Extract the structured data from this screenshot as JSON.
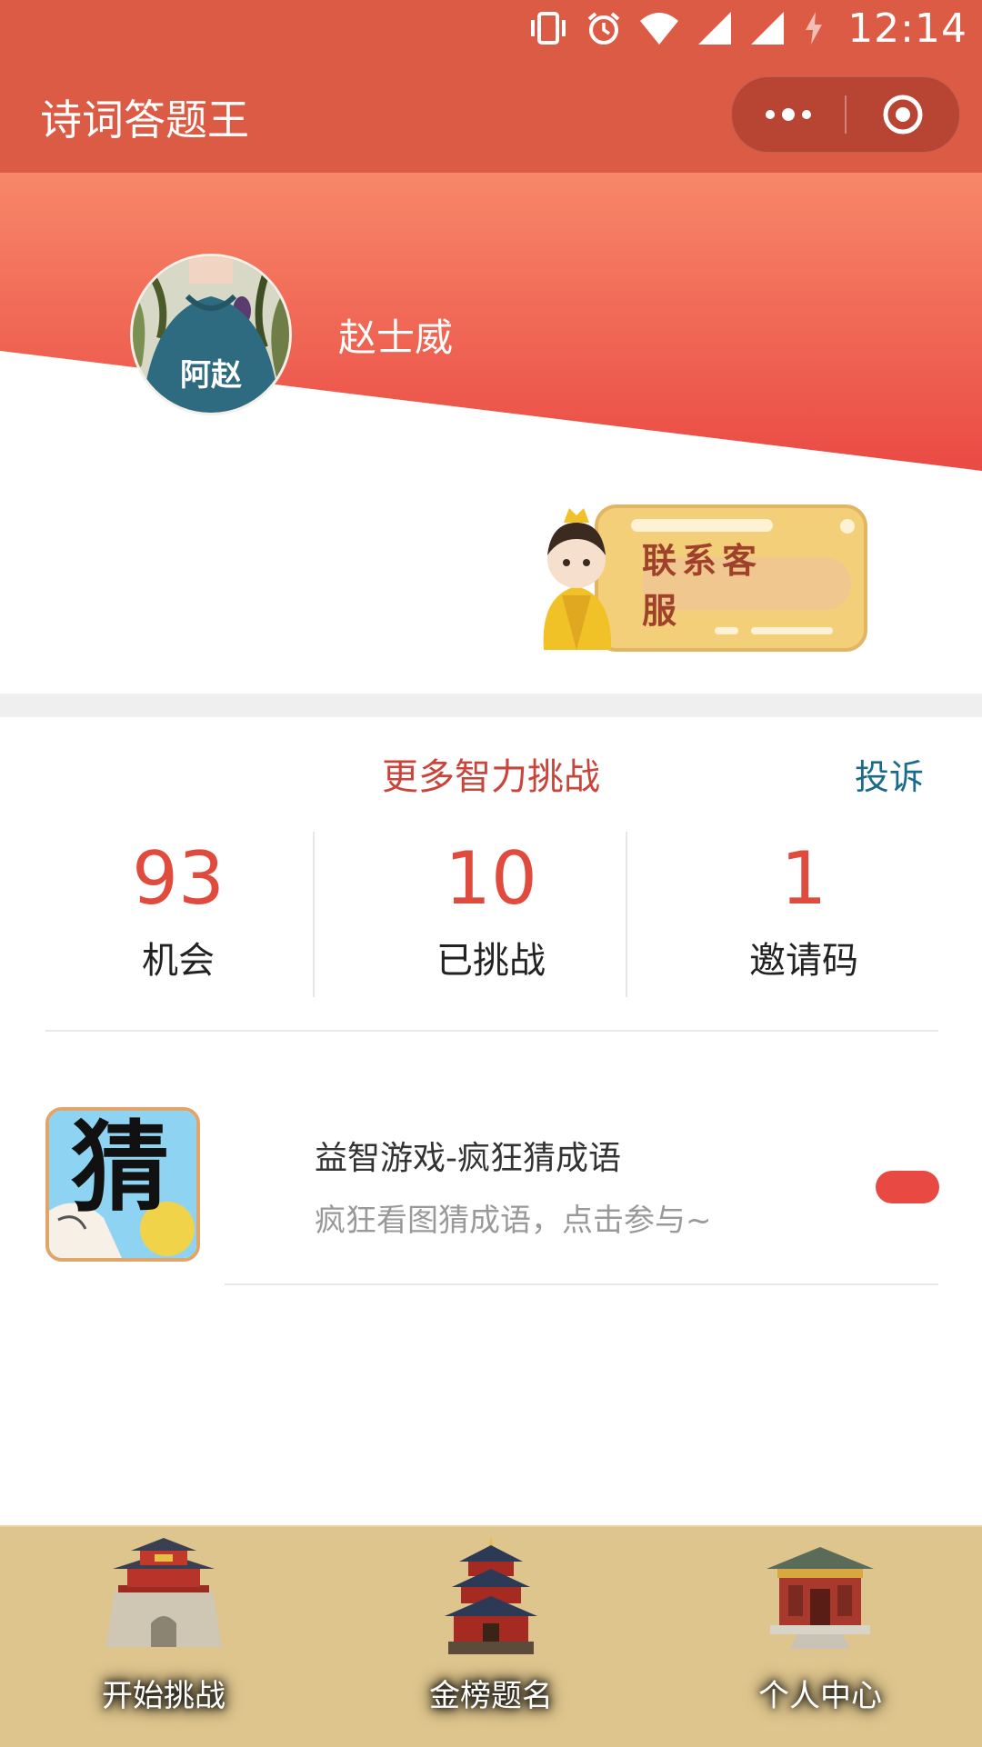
{
  "status_bar": {
    "time": "12:14",
    "icons": [
      "vibrate-icon",
      "alarm-icon",
      "wifi-icon",
      "signal-icon",
      "signal-icon",
      "battery-charging-icon"
    ]
  },
  "nav": {
    "title": "诗词答题王",
    "more_icon": "more-dots-icon",
    "close_icon": "target-close-icon"
  },
  "profile": {
    "avatar_text": "阿赵",
    "username": "赵士威"
  },
  "service_button": {
    "label": "联系客服"
  },
  "section": {
    "title": "更多智力挑战",
    "complain": "投诉"
  },
  "stats": [
    {
      "value": "93",
      "label": "机会"
    },
    {
      "value": "10",
      "label": "已挑战"
    },
    {
      "value": "1",
      "label": "邀请码"
    }
  ],
  "game": {
    "icon_text": "猜",
    "title": "益智游戏-疯狂猜成语",
    "description": "疯狂看图猜成语，点击参与~"
  },
  "tabs": [
    {
      "label": "开始挑战",
      "icon": "palace-gate-icon"
    },
    {
      "label": "金榜题名",
      "icon": "temple-pagoda-icon"
    },
    {
      "label": "个人中心",
      "icon": "hall-icon"
    }
  ],
  "colors": {
    "nav_bg": "#dc5b45",
    "accent_red": "#e04b3e",
    "link_blue": "#1a6b8a",
    "tabbar_bg": "#dec58d"
  }
}
